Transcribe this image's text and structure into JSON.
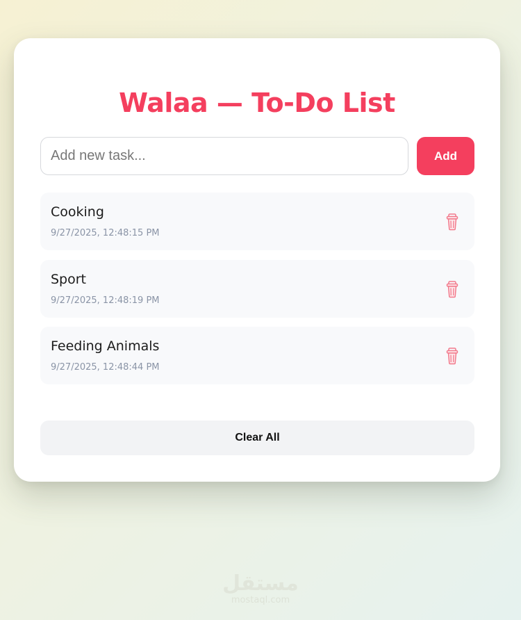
{
  "app": {
    "title": "Walaa — To-Do List",
    "accent_color": "#f43f5e"
  },
  "input": {
    "placeholder": "Add new task...",
    "value": ""
  },
  "buttons": {
    "add_label": "Add",
    "clear_label": "Clear All"
  },
  "tasks": [
    {
      "name": "Cooking",
      "time": "9/27/2025, 12:48:15 PM",
      "delete_icon": "trash-icon"
    },
    {
      "name": "Sport",
      "time": "9/27/2025, 12:48:19 PM",
      "delete_icon": "trash-icon"
    },
    {
      "name": "Feeding Animals",
      "time": "9/27/2025, 12:48:44 PM",
      "delete_icon": "trash-icon"
    }
  ],
  "watermark": {
    "logo_text": "مستقل",
    "domain": "mostaql.com"
  }
}
